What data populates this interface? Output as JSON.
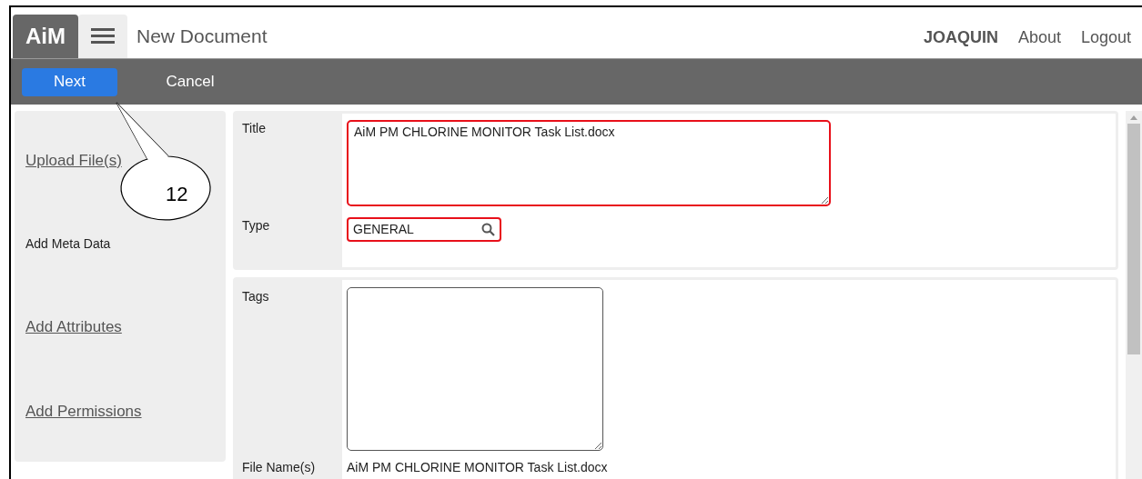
{
  "header": {
    "logo": "AiM",
    "title": "New Document",
    "user": "JOAQUIN",
    "links": [
      "About",
      "Logout"
    ]
  },
  "toolbar": {
    "buttons": [
      {
        "label": "Next",
        "kind": "primary"
      },
      {
        "label": "Cancel",
        "kind": "plain"
      }
    ]
  },
  "steps": [
    {
      "label": "Upload File(s)",
      "selected": false
    },
    {
      "label": "Add Meta Data",
      "selected": true
    },
    {
      "label": "Add Attributes",
      "selected": false
    },
    {
      "label": "Add Permissions",
      "selected": false
    }
  ],
  "form": {
    "title": {
      "label": "Title",
      "value": "AiM PM CHLORINE MONITOR Task List.docx",
      "invalid": true
    },
    "type": {
      "label": "Type",
      "value": "GENERAL",
      "invalid": true
    },
    "tags": {
      "label": "Tags",
      "invalid": false
    },
    "file_names": {
      "label": "File Name(s)",
      "value": "AiM PM CHLORINE MONITOR Task List.docx"
    }
  },
  "callout": {
    "label": "12"
  }
}
